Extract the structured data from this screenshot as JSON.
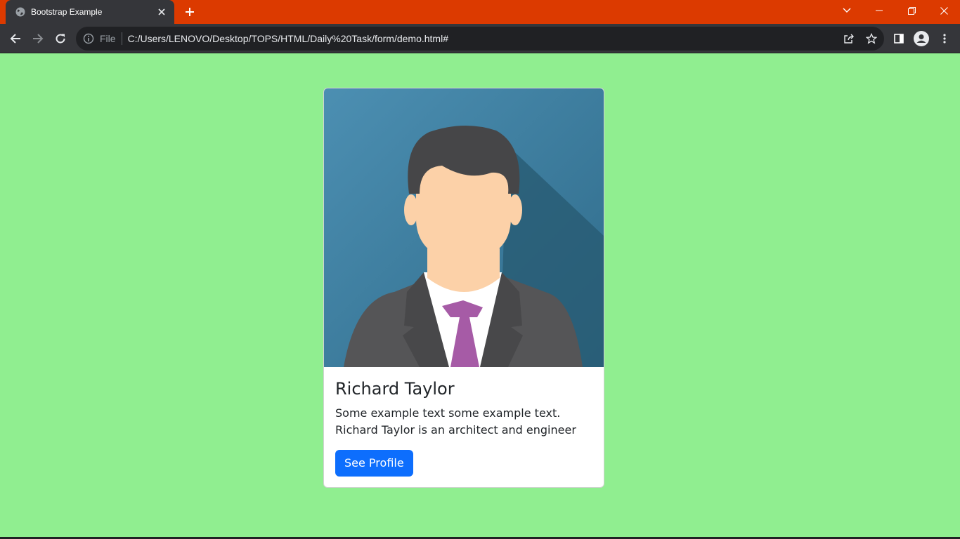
{
  "browser": {
    "tab_title": "Bootstrap Example",
    "new_tab_label": "+",
    "scheme_label": "File",
    "url": "C:/Users/LENOVO/Desktop/TOPS/HTML/Daily%20Task/form/demo.html#",
    "colors": {
      "tabstrip": "#dc3a00",
      "toolbar": "#35363a",
      "omnibox": "#202124"
    }
  },
  "page": {
    "background": "#90ee90",
    "card": {
      "image_icon": "businessman-avatar",
      "title": "Richard Taylor",
      "text": "Some example text some example text. Richard Taylor is an architect and engineer",
      "button_label": "See Profile",
      "button_color": "#0d6efd"
    }
  }
}
